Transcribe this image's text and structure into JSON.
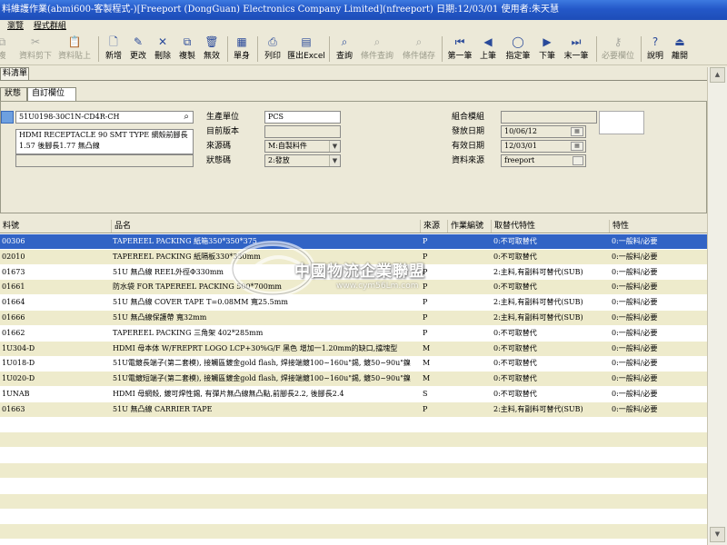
{
  "window": {
    "title": "料維護作業(abmi600-客製程式-)[Freeport (DongGuan) Electronics Company Limited](nfreeport)  日期:12/03/01  使用者:朱天慧"
  },
  "menu": [
    "瀏覽",
    "程式群組"
  ],
  "toolbar": [
    {
      "label": "複",
      "icon": "⧉",
      "enabled": false
    },
    {
      "label": "資料剪下",
      "icon": "✂",
      "enabled": false
    },
    {
      "label": "資料貼上",
      "icon": "📋",
      "enabled": false
    },
    {
      "label": "新增",
      "icon": "🗋",
      "enabled": true
    },
    {
      "label": "更改",
      "icon": "✎",
      "enabled": true
    },
    {
      "label": "刪除",
      "icon": "✕",
      "enabled": true
    },
    {
      "label": "複製",
      "icon": "⧉",
      "enabled": true
    },
    {
      "label": "無效",
      "icon": "🗑",
      "enabled": true
    },
    {
      "label": "單身",
      "icon": "▦",
      "enabled": true
    },
    {
      "label": "列印",
      "icon": "⎙",
      "enabled": true
    },
    {
      "label": "匯出Excel",
      "icon": "▤",
      "enabled": true
    },
    {
      "label": "查詢",
      "icon": "⌕",
      "enabled": true
    },
    {
      "label": "條件查詢",
      "icon": "⌕",
      "enabled": false
    },
    {
      "label": "條件儲存",
      "icon": "⌕",
      "enabled": false
    },
    {
      "label": "第一筆",
      "icon": "⏮",
      "enabled": true
    },
    {
      "label": "上筆",
      "icon": "◀",
      "enabled": true
    },
    {
      "label": "指定筆",
      "icon": "◯",
      "enabled": true
    },
    {
      "label": "下筆",
      "icon": "▶",
      "enabled": true
    },
    {
      "label": "末一筆",
      "icon": "⏭",
      "enabled": true
    },
    {
      "label": "必要欄位",
      "icon": "⚷",
      "enabled": false
    },
    {
      "label": "說明",
      "icon": "?",
      "enabled": true
    },
    {
      "label": "離開",
      "icon": "⏏",
      "enabled": true
    }
  ],
  "form": {
    "tab": "料清單",
    "subtabs": [
      "狀態",
      "自訂欄位"
    ],
    "part_no": "51U0198-30C1N-CD4R-CH",
    "description": "HDMI RECEPTACLE 90 SMT TYPE 網殼前腳長1.57 後腳長1.77 無凸線",
    "labels": {
      "production_unit": "生產單位",
      "bom_version": "目前版本",
      "source_code": "來源碼",
      "status_code": "狀態碼",
      "assembly_module": "組合模組",
      "issue_date": "發放日期",
      "effective_date": "有效日期",
      "data_source": "資料來源"
    },
    "values": {
      "production_unit": "PCS",
      "bom_version": "",
      "source_code": "M:自製料件",
      "status_code": "2:發放",
      "assembly_module": "",
      "issue_date": "10/06/12",
      "effective_date": "12/03/01",
      "data_source": "freeport"
    }
  },
  "grid": {
    "columns": [
      "料號",
      "品名",
      "來源",
      "作業編號",
      "取替代特性",
      "特性"
    ],
    "rows": [
      {
        "item": "00306",
        "name": "TAPEREEL PACKING 紙箱350*350*375",
        "src": "P",
        "op": "",
        "sub": "0:不可取替代",
        "feat": "0:一般料/必要"
      },
      {
        "item": "02010",
        "name": "TAPEREEL PACKING 紙隔板330*330mm",
        "src": "P",
        "op": "",
        "sub": "0:不可取替代",
        "feat": "0:一般料/必要"
      },
      {
        "item": "01673",
        "name": "51U 無凸線  REEL外徑Φ330mm",
        "src": "P",
        "op": "",
        "sub": "2:主料,有副料可替代(SUB)",
        "feat": "0:一般料/必要"
      },
      {
        "item": "01661",
        "name": "防水袋 FOR TAPEREEL PACKING 500*700mm",
        "src": "P",
        "op": "",
        "sub": "0:不可取替代",
        "feat": "0:一般料/必要"
      },
      {
        "item": "01664",
        "name": "51U 無凸線 COVER TAPE T=0.08MM 寬25.5mm",
        "src": "P",
        "op": "",
        "sub": "2:主料,有副料可替代(SUB)",
        "feat": "0:一般料/必要"
      },
      {
        "item": "01666",
        "name": "51U 無凸線保護帶 寬32mm",
        "src": "P",
        "op": "",
        "sub": "2:主料,有副料可替代(SUB)",
        "feat": "0:一般料/必要"
      },
      {
        "item": "01662",
        "name": "TAPEREEL PACKING 三角架 402*285mm",
        "src": "P",
        "op": "",
        "sub": "0:不可取替代",
        "feat": "0:一般料/必要"
      },
      {
        "item": "1U304-D",
        "name": "HDMI 母本体 W/FREPRT LOGO LCP+30%G/F 黑色 增加一1.20mm的缺口,擋塊型",
        "src": "M",
        "op": "",
        "sub": "0:不可取替代",
        "feat": "0:一般料/必要"
      },
      {
        "item": "1U018-D",
        "name": "51U電鍍長端子(第二套模), 接觸區鍍金gold flash, 焊接端鍍100~160u\"錫, 鍍50~90u\"鎳",
        "src": "M",
        "op": "",
        "sub": "0:不可取替代",
        "feat": "0:一般料/必要"
      },
      {
        "item": "1U020-D",
        "name": "51U電鍍短端子(第二套模), 接觸區鍍金gold flash, 焊接端鍍100~160u\"錫, 鍍50~90u\"鎳",
        "src": "M",
        "op": "",
        "sub": "0:不可取替代",
        "feat": "0:一般料/必要"
      },
      {
        "item": "1UNAB",
        "name": "HDMI 母網殼, 鍍可焊性錫, 有彈片無凸線無凸點,前腳長2.2, 後腳長2.4",
        "src": "S",
        "op": "",
        "sub": "0:不可取替代",
        "feat": "0:一般料/必要"
      },
      {
        "item": "01663",
        "name": "51U 無凸線 CARRIER TAPE",
        "src": "P",
        "op": "",
        "sub": "2:主料,有副料可替代(SUB)",
        "feat": "0:一般料/必要"
      }
    ]
  },
  "watermark": {
    "text": "中國物流企業聯盟",
    "url": "www.cym56Lm.com"
  }
}
